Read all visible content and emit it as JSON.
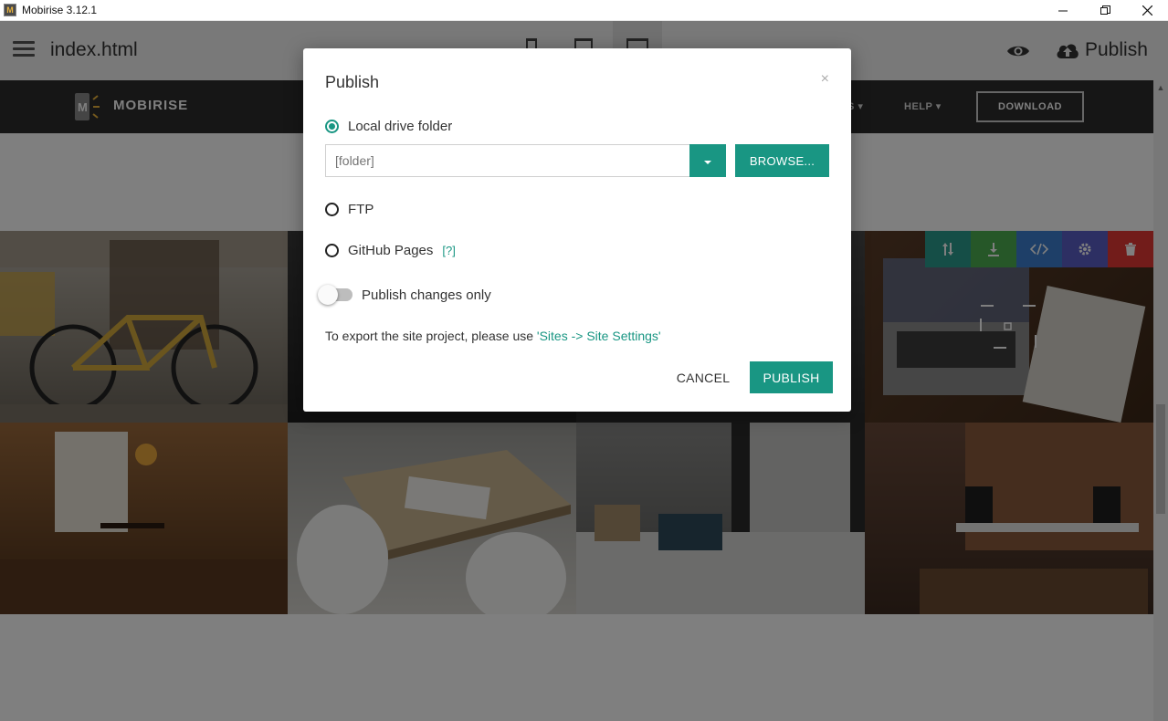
{
  "window": {
    "title": "Mobirise 3.12.1",
    "controls": [
      "minimize",
      "restore",
      "close"
    ]
  },
  "toolbar": {
    "filename": "index.html",
    "devices": [
      "mobile-icon",
      "tablet-icon",
      "desktop-icon"
    ],
    "active_device": "desktop-icon",
    "preview_icon": "eye-icon",
    "publish_label": "Publish"
  },
  "site": {
    "brand": "MOBIRISE",
    "menu_items": [
      "S",
      "HELP"
    ],
    "download_label": "DOWNLOAD",
    "block_tools": [
      "move-icon",
      "save-icon",
      "code-icon",
      "gear-icon",
      "trash-icon"
    ]
  },
  "modal": {
    "title": "Publish",
    "close": "×",
    "options": [
      {
        "label": "Local drive folder",
        "checked": true
      },
      {
        "label": "FTP",
        "checked": false
      },
      {
        "label": "GitHub Pages",
        "checked": false,
        "help": "[?]"
      }
    ],
    "folder_placeholder": "[folder]",
    "browse_label": "BROWSE...",
    "toggle_label": "Publish changes only",
    "toggle_on": false,
    "export_text": "To export the site project, please use ",
    "export_link": "'Sites -> Site Settings'",
    "cancel_label": "CANCEL",
    "publish_label": "PUBLISH"
  },
  "colors": {
    "accent": "#199683",
    "nav_bg": "#2c2c2c",
    "toolbar_bg": "#f2f2f2"
  }
}
